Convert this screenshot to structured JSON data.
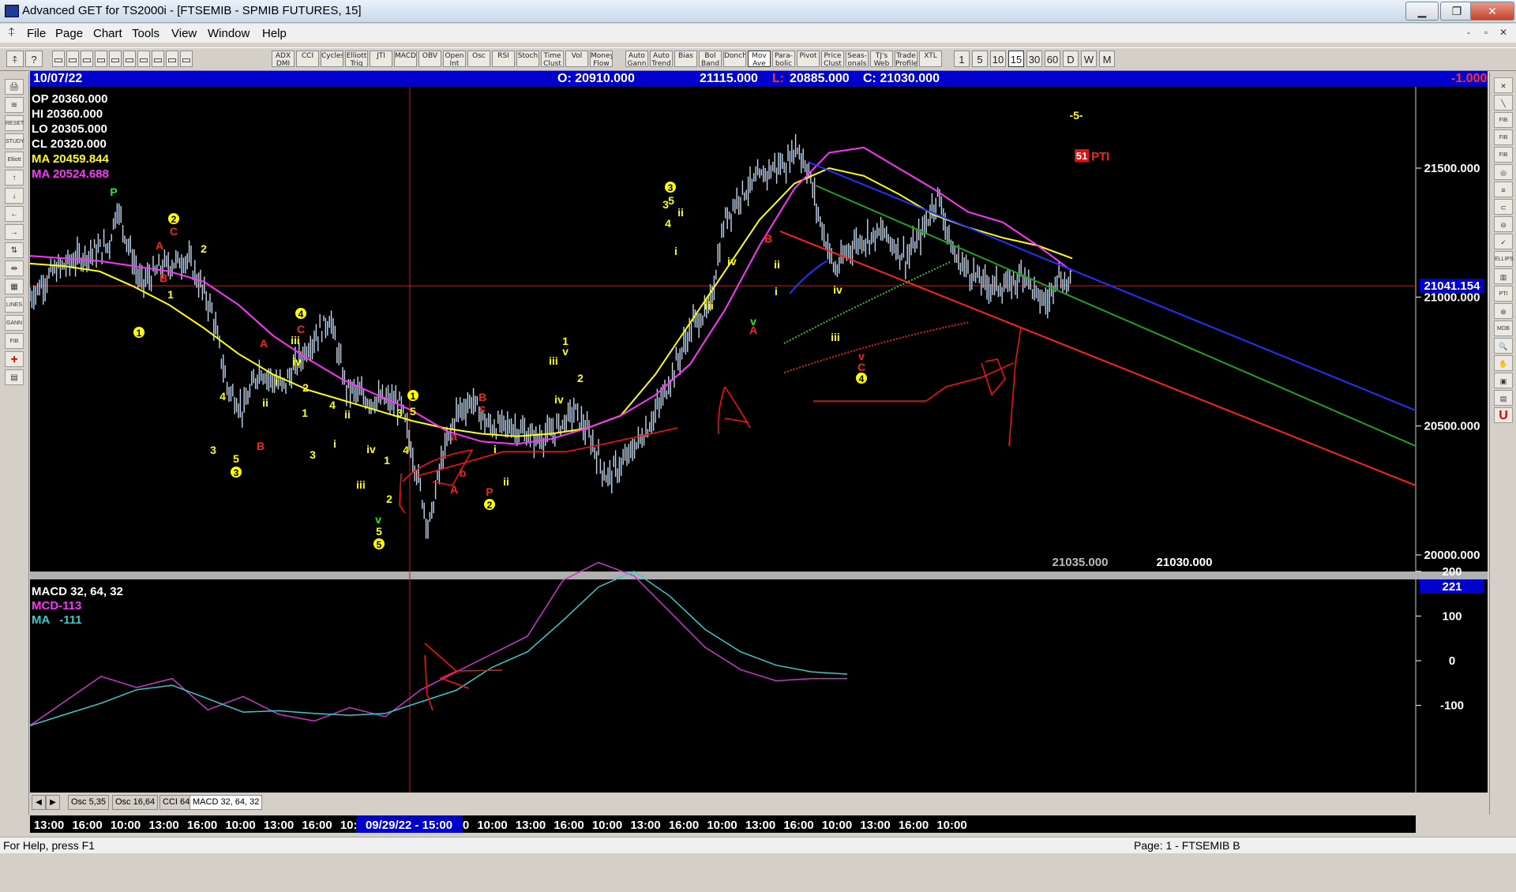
{
  "window": {
    "title": "Advanced GET for TS2000i - [FTSEMIB - SPMIB FUTURES, 15]",
    "min": "▁",
    "max": "❐",
    "close": "✕"
  },
  "menu": [
    "File",
    "Page",
    "Chart",
    "Tools",
    "View",
    "Window",
    "Help"
  ],
  "mdi_controls": [
    "-",
    "▫",
    "✕"
  ],
  "toolbar": {
    "file_icons": [
      "▭",
      "▭",
      "▭",
      "▭",
      "▭",
      "▭",
      "▭",
      "▭",
      "▭",
      "▭"
    ],
    "studies": [
      "ADX DMI",
      "CCI",
      "Cycles",
      "Elliott Trig",
      "JTI",
      "MACD",
      "OBV",
      "Open Int",
      "Osc",
      "RSI",
      "Stoch",
      "Time Clust",
      "Vol",
      "Money Flow"
    ],
    "tools": [
      "Auto Gann",
      "Auto Trend",
      "Bias",
      "Bol Band",
      "Donch",
      "Mov Ave",
      "Para-bolic",
      "Pivot",
      "Price Clust",
      "Seas-onals",
      "TJ's Web",
      "Trade Profile",
      "XTL"
    ],
    "timeframes": [
      "1",
      "5",
      "10",
      "15",
      "30",
      "60",
      "D",
      "W",
      "M"
    ],
    "selected_timeframe": "15"
  },
  "leftbar": [
    "🖨",
    "≋",
    "RESET",
    "STUDY",
    "Elliott",
    "↑",
    "↓",
    "←",
    "→",
    "⇅",
    "⇹",
    "▦",
    "LINES",
    "GANN",
    "FIB",
    "+",
    "▤"
  ],
  "rightbar": [
    "✕",
    "╲",
    "FIB RET",
    "FIB EXT",
    "FIB TIME",
    "◎",
    "≡",
    "⊂",
    "⊖",
    "✓",
    "ELLIPS",
    "▥",
    "PTI",
    "⊛",
    "MOB",
    "🔍",
    "✋",
    "▣",
    "▤",
    "U"
  ],
  "infobar": {
    "date": "10/07/22",
    "open": "O: 20910.000",
    "high": "21115.000",
    "low_label": "L:",
    "low": "20885.000",
    "close": "C: 21030.000",
    "change": "-1.000"
  },
  "price_panel": {
    "ohlc_labels": [
      {
        "label": "OP",
        "value": "20360.000",
        "color": "#ffffff"
      },
      {
        "label": "HI",
        "value": "20360.000",
        "color": "#ffffff"
      },
      {
        "label": "LO",
        "value": "20305.000",
        "color": "#ffffff"
      },
      {
        "label": "CL",
        "value": "20320.000",
        "color": "#ffffff"
      },
      {
        "label": "MA",
        "value": "20459.844",
        "color": "#ffff00"
      },
      {
        "label": "MA",
        "value": "20524.688",
        "color": "#ff33ff"
      }
    ],
    "y_labels": [
      {
        "value": 21500,
        "text": "21500.000"
      },
      {
        "value": 21000,
        "text": "21000.000"
      },
      {
        "value": 20500,
        "text": "20500.000"
      },
      {
        "value": 20000,
        "text": "20000.000"
      }
    ],
    "current_price_tag": "21041.154",
    "bottom_values": [
      "21035.000",
      "21030.000"
    ],
    "pti_number": "51",
    "pti_label": "PTI",
    "top_wave_label": "-5-"
  },
  "macd_panel": {
    "title": "MACD 32, 64, 32",
    "mcd": "MCD-113",
    "ma": "MA   -111",
    "tag": "221",
    "y_labels": [
      {
        "value": 200,
        "text": "200"
      },
      {
        "value": 100,
        "text": "100"
      },
      {
        "value": 0,
        "text": "0"
      },
      {
        "value": -100,
        "text": "-100"
      }
    ]
  },
  "time_axis": {
    "labels": [
      "13:00",
      "16:00",
      "10:00",
      "13:00",
      "16:00",
      "10:00",
      "13:00",
      "16:00",
      "10:00",
      "13:00",
      "16:00",
      "10:00",
      "13:00",
      "16:00",
      "10:00",
      "13:00",
      "16:00",
      "10:00",
      "13:00",
      "16:00",
      "10:00",
      "13:00",
      "16:00",
      "10:00"
    ],
    "cursor_label": "09/29/22 - 15:00"
  },
  "bottom_tabs": [
    "Osc 5,35",
    "Osc 16,64",
    "CCI 64",
    "MACD 32, 64, 32"
  ],
  "bottom_nav": [
    "◀",
    "▶"
  ],
  "status": {
    "help": "For Help, press F1",
    "page": "Page: 1 - FTSEMIB B"
  },
  "colors": {
    "blue_bar": "#0000cc",
    "yellow_ma": "#ffff00",
    "magenta_ma": "#ff33ff",
    "macd_line": "#cc33cc",
    "signal_line": "#33cccc"
  },
  "chart_data": {
    "type": "line",
    "title": "FTSEMIB - SPMIB FUTURES, 15",
    "ylim": [
      19990,
      21700
    ],
    "series": [
      {
        "name": "MA",
        "values": [
          21130,
          21120,
          21100,
          21040,
          20970,
          20880,
          20780,
          20700,
          20640,
          20600,
          20560,
          20520,
          20490,
          20470,
          20460,
          20470,
          20490,
          20540,
          20700,
          20900,
          21100,
          21300,
          21440,
          21500,
          21470,
          21400,
          21320,
          21270,
          21230,
          21200,
          21150
        ]
      },
      {
        "name": "MA",
        "values": [
          21160,
          21150,
          21140,
          21120,
          21100,
          21060,
          20970,
          20850,
          20760,
          20680,
          20620,
          20560,
          20480,
          20440,
          20430,
          20450,
          20490,
          20540,
          20620,
          20740,
          20950,
          21200,
          21420,
          21560,
          21580,
          21500,
          21420,
          21330,
          21290,
          21200,
          21100
        ]
      }
    ]
  },
  "macd_chart": {
    "type": "line",
    "ylim": [
      -170,
      230
    ],
    "series": [
      {
        "name": "MCD",
        "values": [
          -145,
          -90,
          -35,
          -60,
          -40,
          -110,
          -80,
          -120,
          -135,
          -105,
          -125,
          -65,
          -25,
          15,
          55,
          180,
          220,
          190,
          110,
          30,
          -20,
          -45,
          -40,
          -40
        ]
      },
      {
        "name": "MA",
        "values": [
          -145,
          -120,
          -95,
          -65,
          -55,
          -85,
          -115,
          -112,
          -118,
          -122,
          -118,
          -92,
          -66,
          -15,
          20,
          90,
          165,
          200,
          145,
          70,
          20,
          -10,
          -25,
          -30
        ]
      }
    ]
  }
}
